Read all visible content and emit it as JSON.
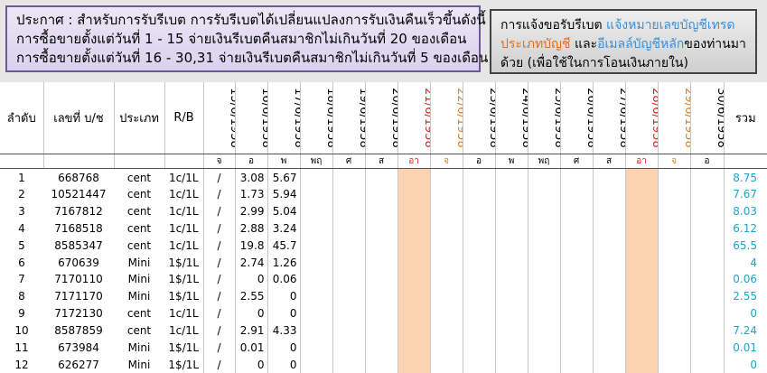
{
  "announcement": {
    "line1": "ประกาศ : สำหรับการรับรีเบต  การรับรีเบตได้เปลี่ยนแปลงการรับเงินคืนเร็วขึ้นดังนี้",
    "line2": "การซื้อขายตั้งแต่วันที่    1 - 15  จ่ายเงินรีเบตคืนสมาชิกไม่เกินวันที่ 20 ของเดือน",
    "line3": "การซื้อขายตั้งแต่วันที่ 16 - 30,31 จ่ายเงินรีเบตคืนสมาชิกไม่เกินวันที่  5  ของเดือน"
  },
  "notice": {
    "l1a": "การแจ้งขอรับรีเบต  ",
    "l1b": "แจ้งหมายเลขบัญชีเทรด",
    "l2a": "ประเภทบัญชี",
    "l2b": " และ",
    "l2c": "อีเมลล์บัญชีหลัก",
    "l2d": "ของท่านมา",
    "l3": "ด้วย   (เพื่อใช้ในการโอนเงินภายใน)"
  },
  "columns": {
    "no": "ลำดับ",
    "account": "เลขที่ บ/ช",
    "type": "ประเภท",
    "rb": "R/B",
    "total": "รวม"
  },
  "dates": [
    {
      "label": "15/6/1958",
      "day": "จ",
      "color": ""
    },
    {
      "label": "16/6/1958",
      "day": "อ",
      "color": ""
    },
    {
      "label": "17/6/1958",
      "day": "พ",
      "color": ""
    },
    {
      "label": "18/6/1958",
      "day": "พฤ",
      "color": ""
    },
    {
      "label": "19/6/1958",
      "day": "ศ",
      "color": ""
    },
    {
      "label": "20/6/1958",
      "day": "ส",
      "color": ""
    },
    {
      "label": "21/6/1958",
      "day": "อา",
      "color": "red"
    },
    {
      "label": "22/6/1958",
      "day": "จ",
      "color": "org"
    },
    {
      "label": "23/6/1958",
      "day": "อ",
      "color": ""
    },
    {
      "label": "24/6/1958",
      "day": "พ",
      "color": ""
    },
    {
      "label": "25/6/1958",
      "day": "พฤ",
      "color": ""
    },
    {
      "label": "26/6/1958",
      "day": "ศ",
      "color": ""
    },
    {
      "label": "27/6/1958",
      "day": "ส",
      "color": ""
    },
    {
      "label": "28/6/1958",
      "day": "อา",
      "color": "red"
    },
    {
      "label": "29/6/1958",
      "day": "จ",
      "color": "org"
    },
    {
      "label": "30/6/1958",
      "day": "อ",
      "color": ""
    }
  ],
  "rows": [
    {
      "no": "1",
      "account": "668768",
      "type": "cent",
      "rb": "1c/1L",
      "mark": "/",
      "d16": "3.08",
      "d17": "5.67",
      "total": "8.75"
    },
    {
      "no": "2",
      "account": "10521447",
      "type": "cent",
      "rb": "1c/1L",
      "mark": "/",
      "d16": "1.73",
      "d17": "5.94",
      "total": "7.67"
    },
    {
      "no": "3",
      "account": "7167812",
      "type": "cent",
      "rb": "1c/1L",
      "mark": "/",
      "d16": "2.99",
      "d17": "5.04",
      "total": "8.03"
    },
    {
      "no": "4",
      "account": "7168518",
      "type": "cent",
      "rb": "1c/1L",
      "mark": "/",
      "d16": "2.88",
      "d17": "3.24",
      "total": "6.12"
    },
    {
      "no": "5",
      "account": "8585347",
      "type": "cent",
      "rb": "1c/1L",
      "mark": "/",
      "d16": "19.8",
      "d17": "45.7",
      "total": "65.5"
    },
    {
      "no": "6",
      "account": "670639",
      "type": "Mini",
      "rb": "1$/1L",
      "mark": "/",
      "d16": "2.74",
      "d17": "1.26",
      "total": "4"
    },
    {
      "no": "7",
      "account": "7170110",
      "type": "Mini",
      "rb": "1$/1L",
      "mark": "/",
      "d16": "0",
      "d17": "0.06",
      "total": "0.06"
    },
    {
      "no": "8",
      "account": "7171170",
      "type": "Mini",
      "rb": "1$/1L",
      "mark": "/",
      "d16": "2.55",
      "d17": "0",
      "total": "2.55"
    },
    {
      "no": "9",
      "account": "7172130",
      "type": "cent",
      "rb": "1c/1L",
      "mark": "/",
      "d16": "0",
      "d17": "0",
      "total": "0"
    },
    {
      "no": "10",
      "account": "8587859",
      "type": "cent",
      "rb": "1c/1L",
      "mark": "/",
      "d16": "2.91",
      "d17": "4.33",
      "total": "7.24"
    },
    {
      "no": "11",
      "account": "673984",
      "type": "Mini",
      "rb": "1$/1L",
      "mark": "/",
      "d16": "0.01",
      "d17": "0",
      "total": "0.01"
    },
    {
      "no": "12",
      "account": "626277",
      "type": "Mini",
      "rb": "1$/1L",
      "mark": "/",
      "d16": "0",
      "d17": "0",
      "total": "0"
    }
  ]
}
